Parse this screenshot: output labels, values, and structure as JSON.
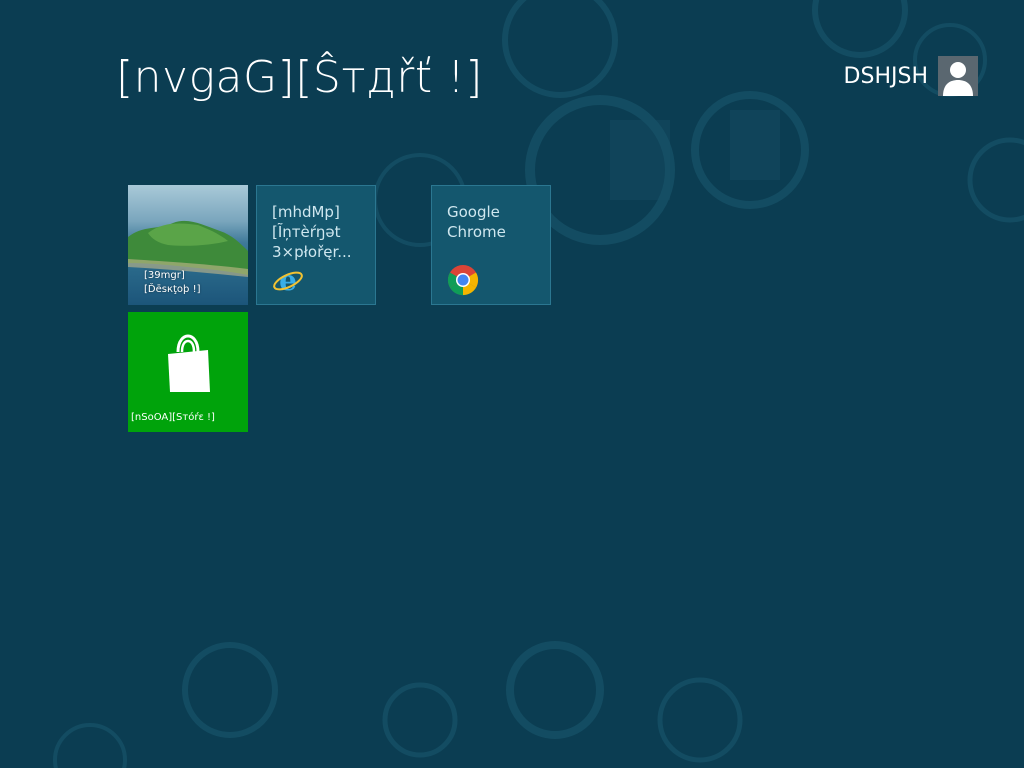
{
  "start": {
    "title": "[nvgaG][Ŝтдřť !]"
  },
  "user": {
    "name": "DSHJSH",
    "avatar_icon": "user-silhouette-icon"
  },
  "tiles": {
    "desktop": {
      "label_line1": "[39mgr]",
      "label_line2": "[Ďēsкţoþ !]"
    },
    "ie": {
      "label": "[mhdMp]\n[Ĩņтèŕŋət\n3×płořęr...",
      "icon": "internet-explorer-icon"
    },
    "chrome": {
      "label": "Google\nChrome",
      "icon": "chrome-icon"
    },
    "store": {
      "label": "[nSoOA][Sтóŕε !]",
      "icon": "shopping-bag-icon"
    }
  },
  "colors": {
    "background": "#0b3d52",
    "tile_default": "#14576e",
    "tile_store": "#00a30b"
  }
}
